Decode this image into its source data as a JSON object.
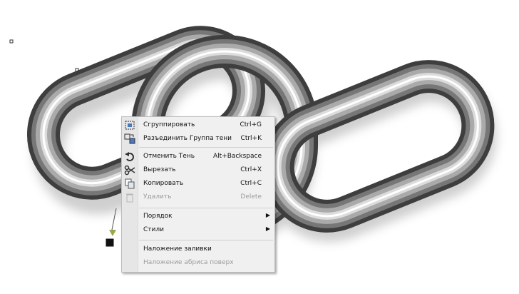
{
  "menu": {
    "items": [
      {
        "label": "Сгруппировать",
        "shortcut": "Ctrl+G",
        "icon": "group-icon",
        "enabled": true
      },
      {
        "label": "Разъединить Группа тени",
        "shortcut": "Ctrl+K",
        "icon": "break-apart-icon",
        "enabled": true
      },
      {
        "label": "Отменить Тень",
        "shortcut": "Alt+Backspace",
        "icon": "undo-icon",
        "enabled": true
      },
      {
        "label": "Вырезать",
        "shortcut": "Ctrl+X",
        "icon": "scissors-icon",
        "enabled": true
      },
      {
        "label": "Копировать",
        "shortcut": "Ctrl+C",
        "icon": "copy-icon",
        "enabled": true
      },
      {
        "label": "Удалить",
        "shortcut": "Delete",
        "icon": "trash-icon",
        "enabled": false
      },
      {
        "label": "Порядок",
        "submenu": true,
        "enabled": true
      },
      {
        "label": "Стили",
        "submenu": true,
        "enabled": true
      },
      {
        "label": "Наложение заливки",
        "enabled": true
      },
      {
        "label": "Наложение абриса поверх",
        "enabled": false
      }
    ]
  },
  "colors": {
    "menu_bg": "#f0f0f0",
    "gutter": "#e6e6e6",
    "disabled_text": "#9c9c9c",
    "chain_dark": "#3a3a3a",
    "chain_light": "#ffffff"
  }
}
